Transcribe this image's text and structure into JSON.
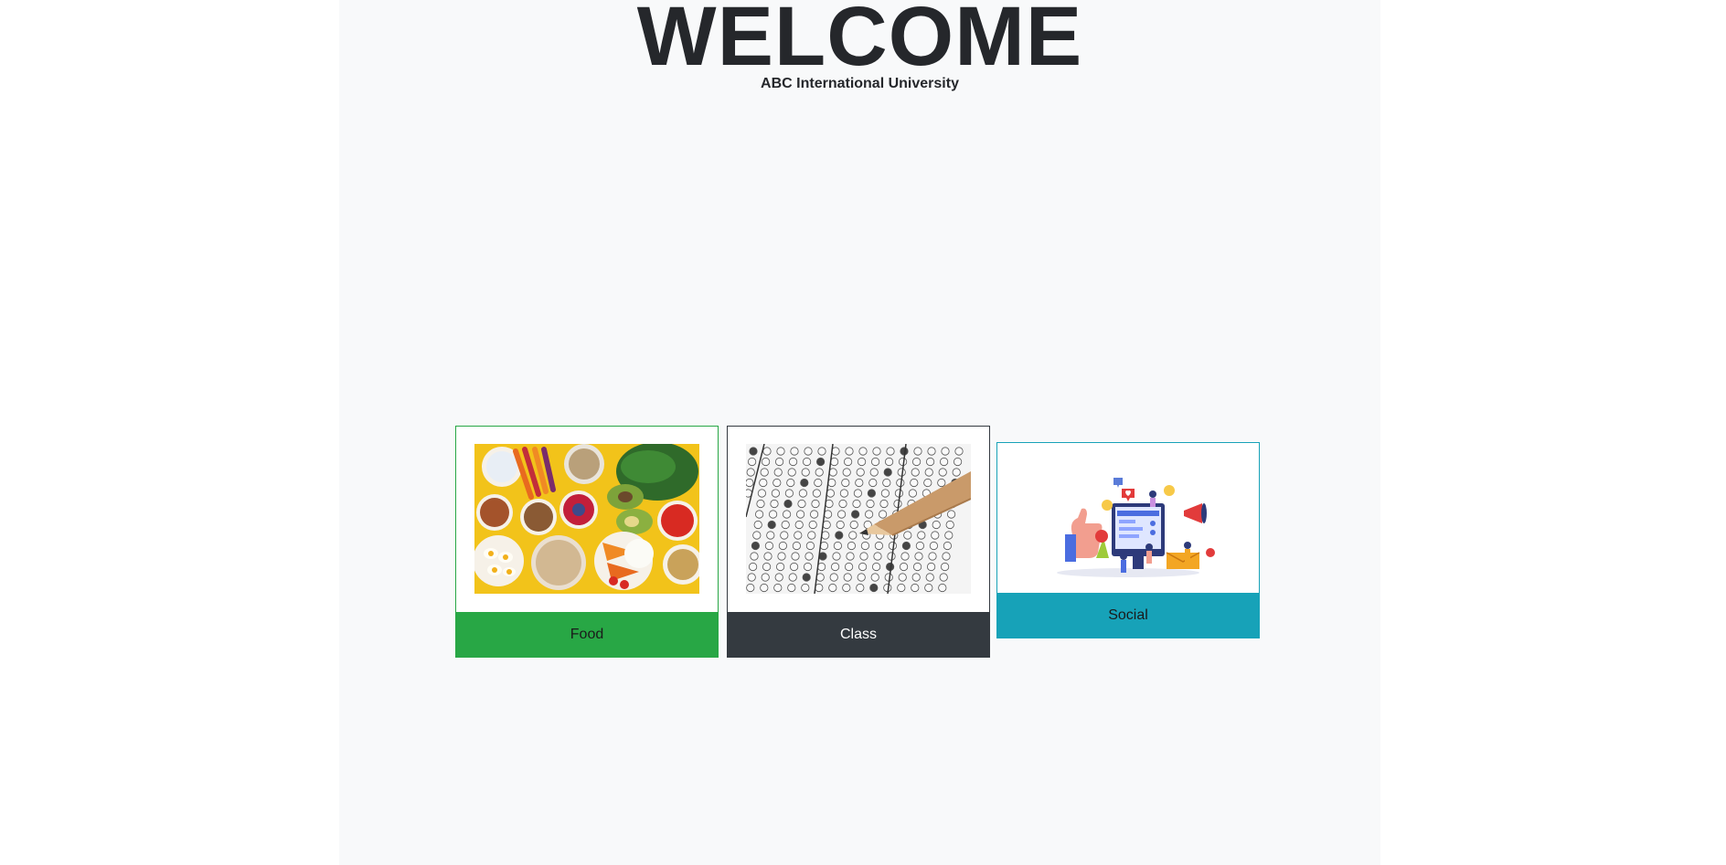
{
  "header": {
    "title": "WELCOME",
    "subtitle": "ABC International University"
  },
  "cards": [
    {
      "label": "Food",
      "image": "food-bowls-image",
      "color": "#28a745"
    },
    {
      "label": "Class",
      "image": "answer-sheet-pencil-image",
      "color": "#343a40"
    },
    {
      "label": "Social",
      "image": "social-media-illustration",
      "color": "#17a2b8"
    }
  ]
}
